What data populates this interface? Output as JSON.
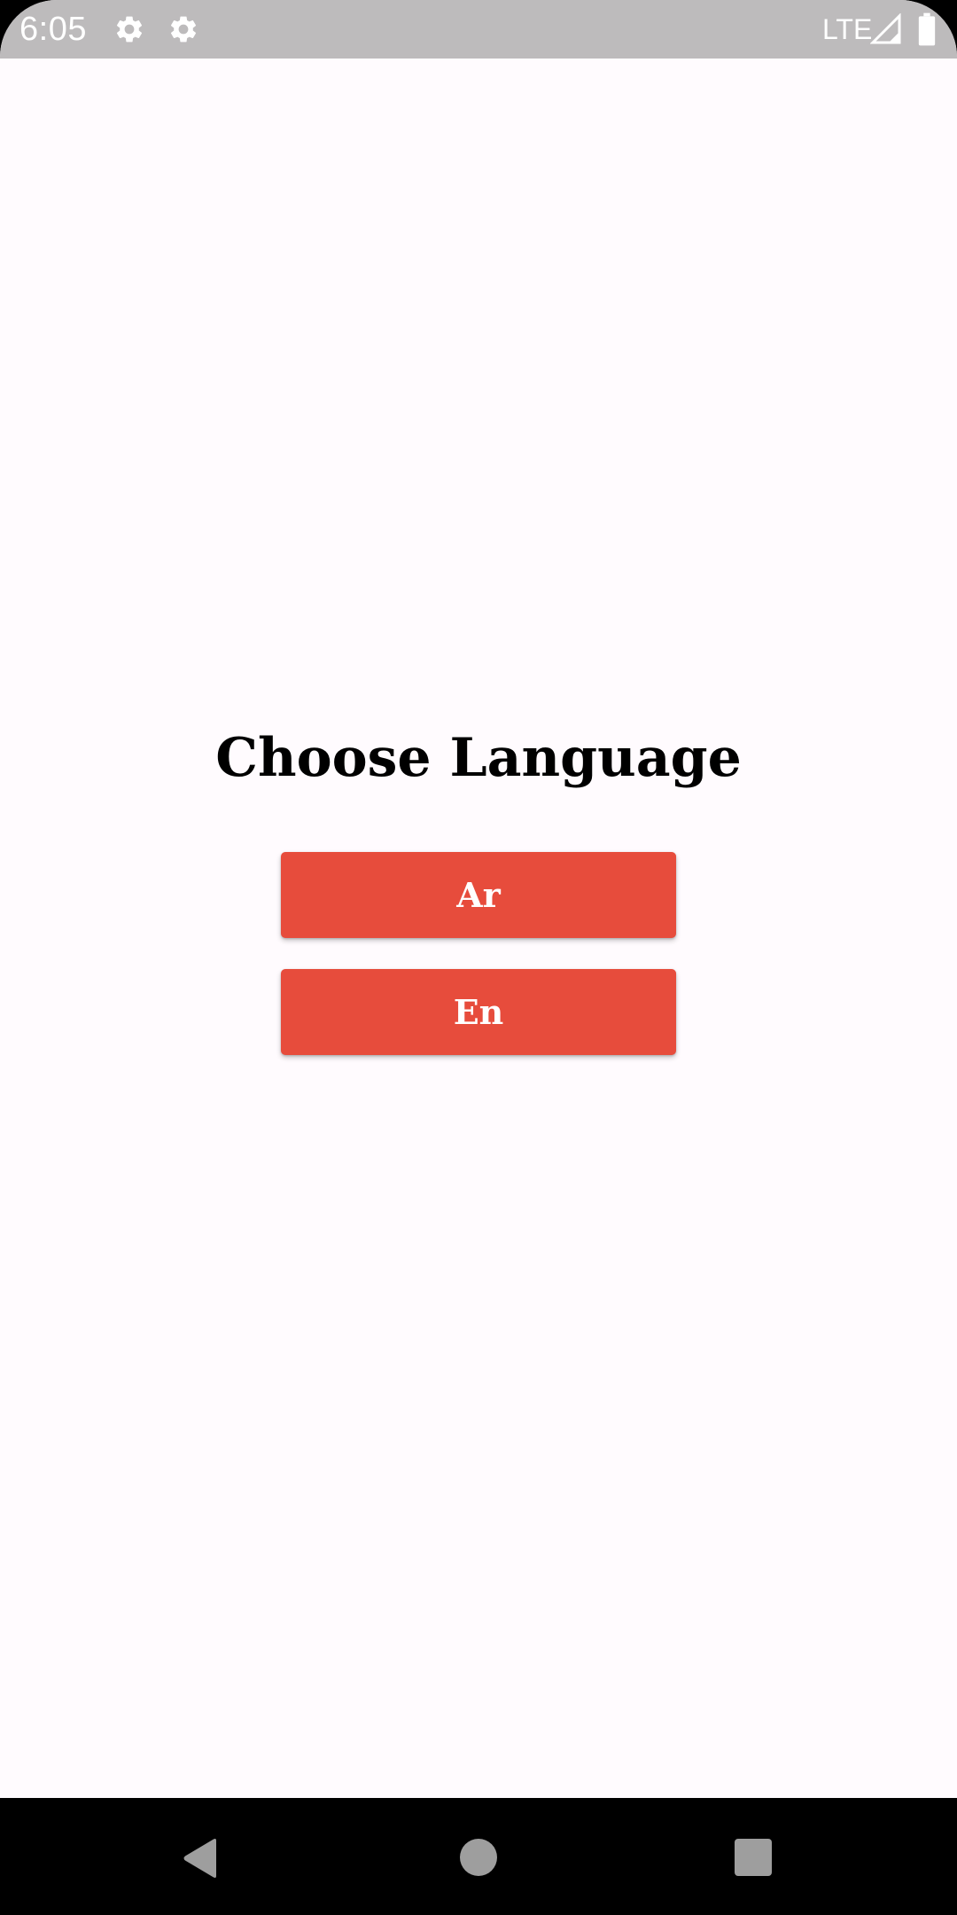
{
  "status_bar": {
    "time": "6:05",
    "network": "LTE",
    "icons": [
      "settings-gear-icon",
      "settings-gear-icon",
      "signal-icon",
      "battery-icon"
    ]
  },
  "main": {
    "title": "Choose Language",
    "buttons": [
      {
        "label": "Ar"
      },
      {
        "label": "En"
      }
    ]
  },
  "nav_bar": {
    "icons": [
      "back-icon",
      "home-icon",
      "recents-icon"
    ]
  },
  "colors": {
    "accent": "#e74c3c",
    "background": "#fffbfe",
    "status_bar": "#bdbbbc",
    "nav_bar": "#000000"
  }
}
